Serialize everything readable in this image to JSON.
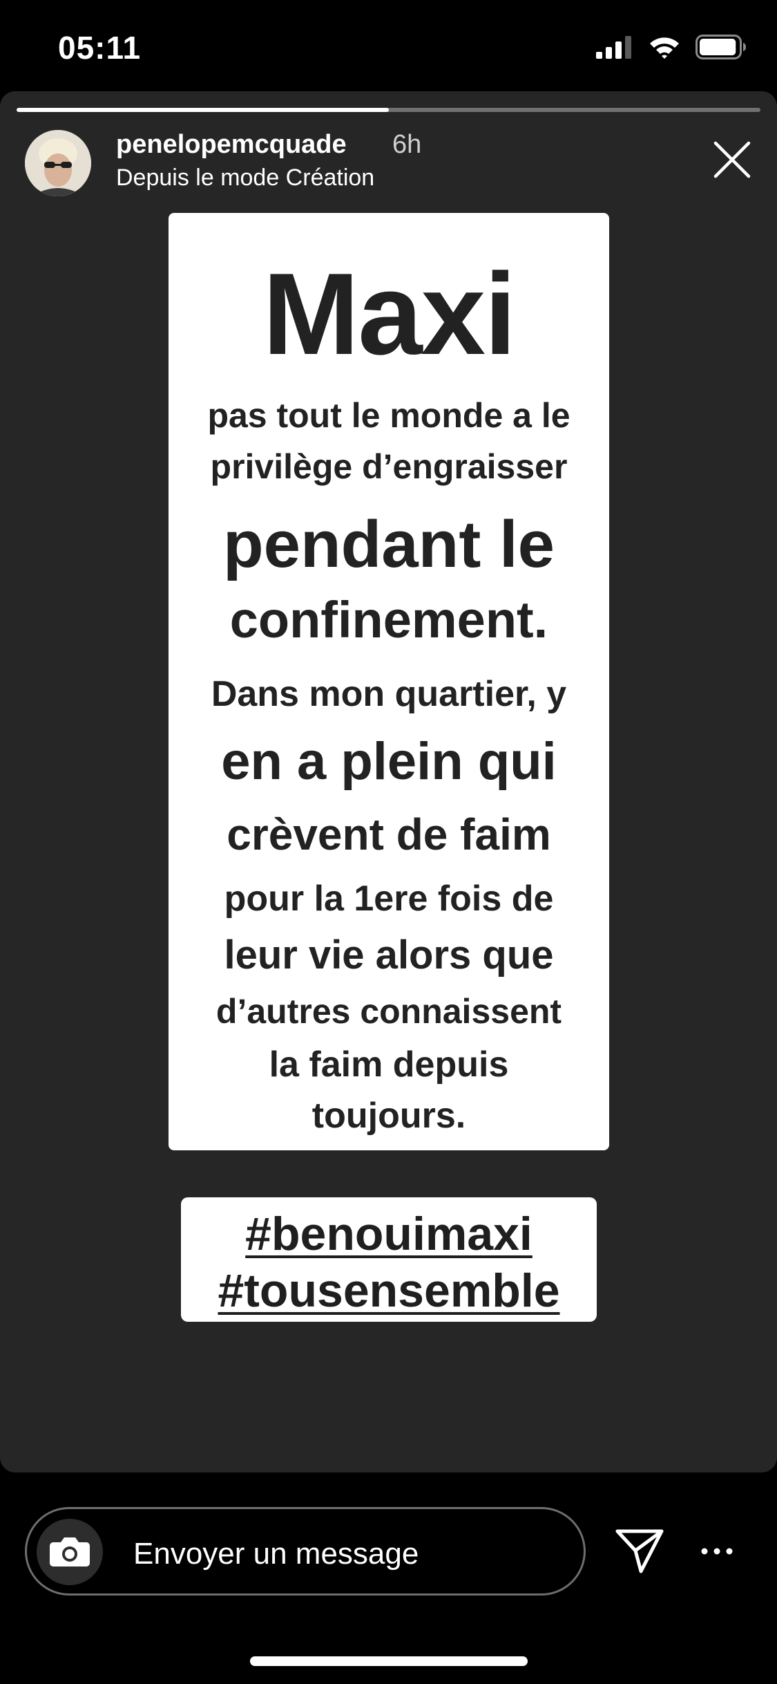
{
  "status_bar": {
    "time": "05:11",
    "signal_icon": "cellular-signal-icon",
    "wifi_icon": "wifi-icon",
    "battery_icon": "battery-icon",
    "battery_level": 0.95
  },
  "story": {
    "progress": 0.5,
    "username": "penelopemcquade",
    "time_ago": "6h",
    "subtitle": "Depuis le mode Création",
    "avatar_icon": "profile-avatar",
    "close_icon": "close-icon",
    "text_card": {
      "lines": [
        "Maxi",
        "pas tout le monde a le",
        "privilège d’engraisser",
        "pendant le",
        "confinement.",
        "Dans mon quartier, y",
        "en a plein qui",
        "crèvent de faim",
        "pour la 1ere fois de",
        "leur vie alors que",
        "d’autres connaissent",
        "la faim depuis",
        "toujours."
      ]
    },
    "hashtags": [
      "#benouimaxi",
      "#tousensemble"
    ]
  },
  "reply_bar": {
    "placeholder": "Envoyer un message",
    "camera_icon": "camera-icon",
    "send_icon": "send-icon",
    "more_icon": "more-options-icon"
  },
  "colors": {
    "background": "#000000",
    "story_background": "#262626",
    "card_background": "#ffffff",
    "card_text": "#222222"
  }
}
